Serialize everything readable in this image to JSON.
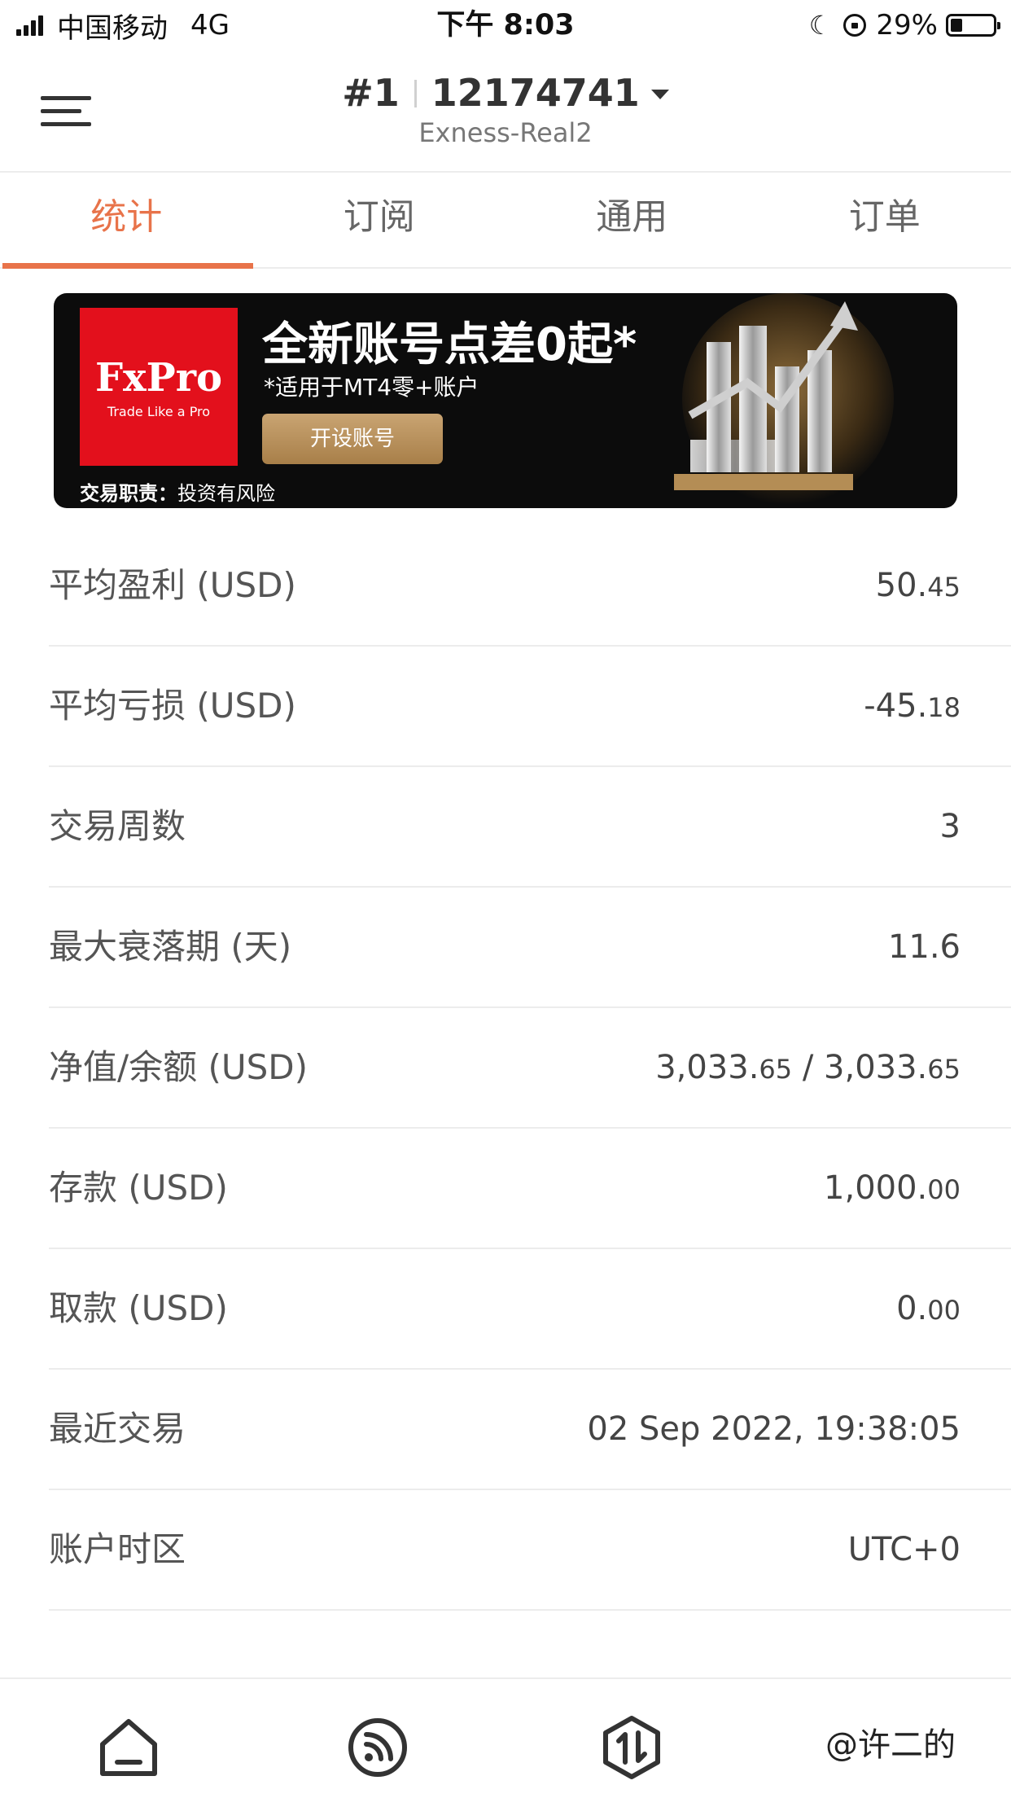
{
  "status_bar": {
    "carrier": "中国移动",
    "network": "4G",
    "time": "下午 8:03",
    "battery": "29%",
    "battery_level": 0.29
  },
  "header": {
    "account_index": "#1",
    "account_number": "12174741",
    "server": "Exness-Real2"
  },
  "tabs": [
    {
      "label": "统计",
      "active": true
    },
    {
      "label": "订阅",
      "active": false
    },
    {
      "label": "通用",
      "active": false
    },
    {
      "label": "订单",
      "active": false
    }
  ],
  "banner": {
    "brand": "FxPro",
    "brand_tagline": "Trade Like a Pro",
    "headline": "全新账号点差0起*",
    "subline": "*适用于MT4零+账户",
    "cta": "开设账号",
    "risk_label": "交易职责：",
    "risk_text": "投资有风险",
    "brand_color": "#e3101c"
  },
  "stats": [
    {
      "label": "平均盈利 (USD)",
      "value_main": "50.",
      "value_dec": "45"
    },
    {
      "label": "平均亏损 (USD)",
      "value_main": "-45.",
      "value_dec": "18"
    },
    {
      "label": "交易周数",
      "value_main": "3",
      "value_dec": ""
    },
    {
      "label": "最大衰落期 (天)",
      "value_main": "11.6",
      "value_dec": ""
    },
    {
      "label": "净值/余额 (USD)",
      "value_main": "3,033.",
      "value_dec": "65",
      "value_main2": " / 3,033.",
      "value_dec2": "65"
    },
    {
      "label": "存款 (USD)",
      "value_main": "1,000.",
      "value_dec": "00"
    },
    {
      "label": "取款 (USD)",
      "value_main": "0.",
      "value_dec": "00"
    },
    {
      "label": "最近交易",
      "value_main": "02 Sep 2022, 19:38:05",
      "value_dec": ""
    },
    {
      "label": "账户时区",
      "value_main": "UTC+0",
      "value_dec": ""
    }
  ],
  "bottom_nav": [
    {
      "icon": "home-icon"
    },
    {
      "icon": "signal-feed-icon"
    },
    {
      "icon": "trade-arrows-icon"
    }
  ],
  "watermark": "@许二的",
  "colors": {
    "accent": "#e8734a",
    "divider": "#ececec"
  }
}
